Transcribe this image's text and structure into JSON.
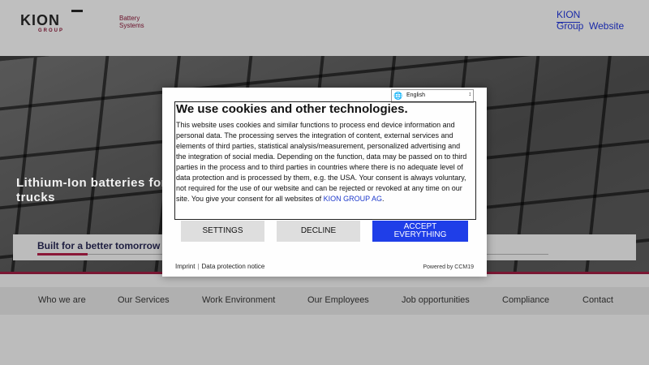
{
  "header": {
    "brand_name": "KION",
    "brand_sub": "GROUP",
    "subbrand_line1": "Battery",
    "subbrand_line2": "Systems",
    "group_site_word1": "KION",
    "group_site_rest": "Group  Website",
    "colors": {
      "accent": "#6a1029",
      "link": "#1a2aa8"
    }
  },
  "hero": {
    "title": "Lithium-Ion batteries for trucks",
    "card_text": "Built for a better tomorrow"
  },
  "nav": {
    "items": [
      {
        "label": "Who we are"
      },
      {
        "label": "Our Services"
      },
      {
        "label": "Work Environment"
      },
      {
        "label": "Our Employees"
      },
      {
        "label": "Job opportunities"
      },
      {
        "label": "Compliance"
      },
      {
        "label": "Contact"
      }
    ]
  },
  "cookie": {
    "language": "English",
    "language_icon": "translate-icon",
    "title": "We use cookies and other technologies.",
    "body": "This website uses cookies and similar functions to process end device information and personal data. The processing serves the integration of content, external services and elements of third parties, statistical analysis/measurement, personalized advertising and the integration of social media. Depending on the function, data may be passed on to third parties in the process and to third parties in countries where there is no adequate level of data protection and is processed by them, e.g. the USA. Your consent is always voluntary, not required for the use of our website and can be rejected or revoked at any time on our site. You give your consent for all websites of ",
    "body_link": "KION GROUP AG",
    "body_end": ".",
    "settings_label": "SETTINGS",
    "decline_label": "DECLINE",
    "accept_line1": "ACCEPT",
    "accept_line2": "EVERYTHING",
    "imprint_label": "Imprint",
    "privacy_label": "Data protection notice",
    "powered_by": "Powered by CCM19",
    "accent_color": "#1f3ee8"
  }
}
